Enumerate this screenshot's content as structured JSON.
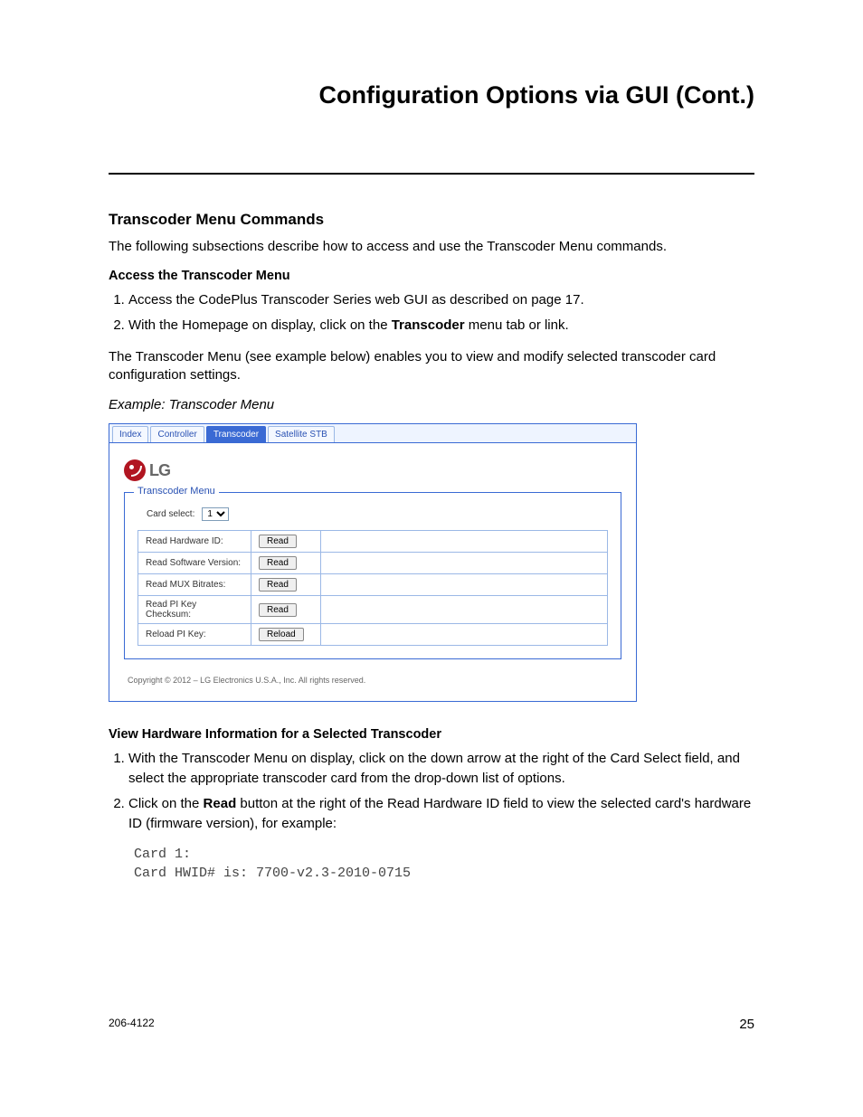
{
  "page_title": "Configuration Options via GUI (Cont.)",
  "section_heading": "Transcoder Menu Commands",
  "section_intro": "The following subsections describe how to access and use the Transcoder Menu commands.",
  "sub1": {
    "heading": "Access the Transcoder Menu",
    "step1": "Access the CodePlus Transcoder Series web GUI as described on page 17.",
    "step2_pre": "With the Homepage on display, click on the ",
    "step2_bold": "Transcoder",
    "step2_post": " menu tab or link."
  },
  "after_steps": "The Transcoder Menu (see example below) enables you to view and modify selected transcoder card configuration settings.",
  "caption": "Example: Transcoder Menu",
  "gui": {
    "tabs": [
      "Index",
      "Controller",
      "Transcoder",
      "Satellite STB"
    ],
    "active_tab_index": 2,
    "logo_text": "LG",
    "legend": "Transcoder Menu",
    "card_select_label": "Card select:",
    "card_select_value": "1",
    "rows": [
      {
        "label": "Read Hardware ID:",
        "btn": "Read"
      },
      {
        "label": "Read Software Version:",
        "btn": "Read"
      },
      {
        "label": "Read MUX Bitrates:",
        "btn": "Read"
      },
      {
        "label": "Read PI Key Checksum:",
        "btn": "Read"
      },
      {
        "label": "Reload PI Key:",
        "btn": "Reload"
      }
    ],
    "copyright": "Copyright © 2012 – LG Electronics U.S.A., Inc. All rights reserved."
  },
  "sub2": {
    "heading": "View Hardware Information for a Selected Transcoder",
    "step1": "With the Transcoder Menu on display, click on the down arrow at the right of the Card Select field, and select the appropriate transcoder card from the drop-down list of options.",
    "step2_pre": "Click on the ",
    "step2_bold": "Read",
    "step2_post": " button at the right of the Read Hardware ID field to view the selected card's hardware ID (firmware version), for example:"
  },
  "code_sample": "Card 1:\nCard HWID# is: 7700-v2.3-2010-0715",
  "footer": {
    "docnum": "206-4122",
    "pagenum": "25"
  }
}
